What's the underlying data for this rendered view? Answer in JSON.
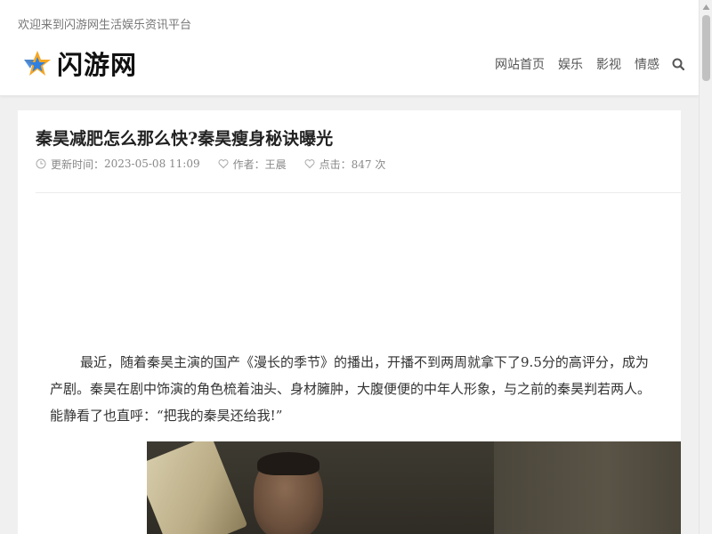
{
  "site": {
    "welcome": "欢迎来到闪游网生活娱乐资讯平台",
    "logo_text": "闪游网",
    "logo_icon": "star-icon",
    "brand_colors": {
      "star_blue": "#2f7fe0",
      "star_orange": "#f5a623"
    }
  },
  "nav": {
    "items": [
      "网站首页",
      "娱乐",
      "影视",
      "情感"
    ],
    "search_icon": "search-icon"
  },
  "article": {
    "title": "秦昊减肥怎么那么快?秦昊瘦身秘诀曝光",
    "updated_label": "更新时间：",
    "updated_value": "2023-05-08 11:09",
    "author_label": "作者：",
    "author_value": "王晨",
    "views_label": "点击：",
    "views_value": "847 次",
    "paragraph_lines": [
      "最近，随着秦昊主演的国产《漫长的季节》的播出，开播不到两周就拿下了9.5分的高评分，成为",
      "产剧。秦昊在剧中饰演的角色梳着油头、身材臃肿，大腹便便的中年人形象，与之前的秦昊判若两人。",
      "能静看了也直呼：“把我的秦昊还给我!”"
    ]
  }
}
